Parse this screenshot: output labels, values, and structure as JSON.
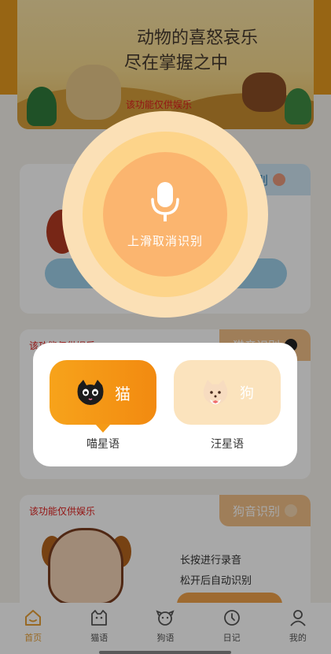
{
  "banner": {
    "title_line1": "动物的喜怒哀乐",
    "title_line2": "尽在掌握之中",
    "note": "该功能仅供娱乐"
  },
  "cards": {
    "card1_tag": "识别",
    "card2_note": "该功能仅供娱乐",
    "card2_tag": "猫音识别",
    "card3_note": "该功能仅供娱乐",
    "card3_tag": "狗音识别",
    "hint_press": "长按进行录音",
    "hint_release": "松开后自动识别"
  },
  "voice": {
    "label": "上滑取消识别"
  },
  "dialog": {
    "cat_label": "猫",
    "cat_caption": "喵星语",
    "dog_label": "狗",
    "dog_caption": "汪星语"
  },
  "nav": {
    "items": [
      {
        "label": "首页",
        "icon": "home-icon",
        "active": true
      },
      {
        "label": "猫语",
        "icon": "cat-icon",
        "active": false
      },
      {
        "label": "狗语",
        "icon": "dog-icon",
        "active": false
      },
      {
        "label": "日记",
        "icon": "clock-icon",
        "active": false
      },
      {
        "label": "我的",
        "icon": "user-icon",
        "active": false
      }
    ]
  },
  "colors": {
    "accent": "#e7a037",
    "cat_option": "#f49a16",
    "dog_option": "#fbe3bd",
    "note_red": "#e0211f"
  }
}
